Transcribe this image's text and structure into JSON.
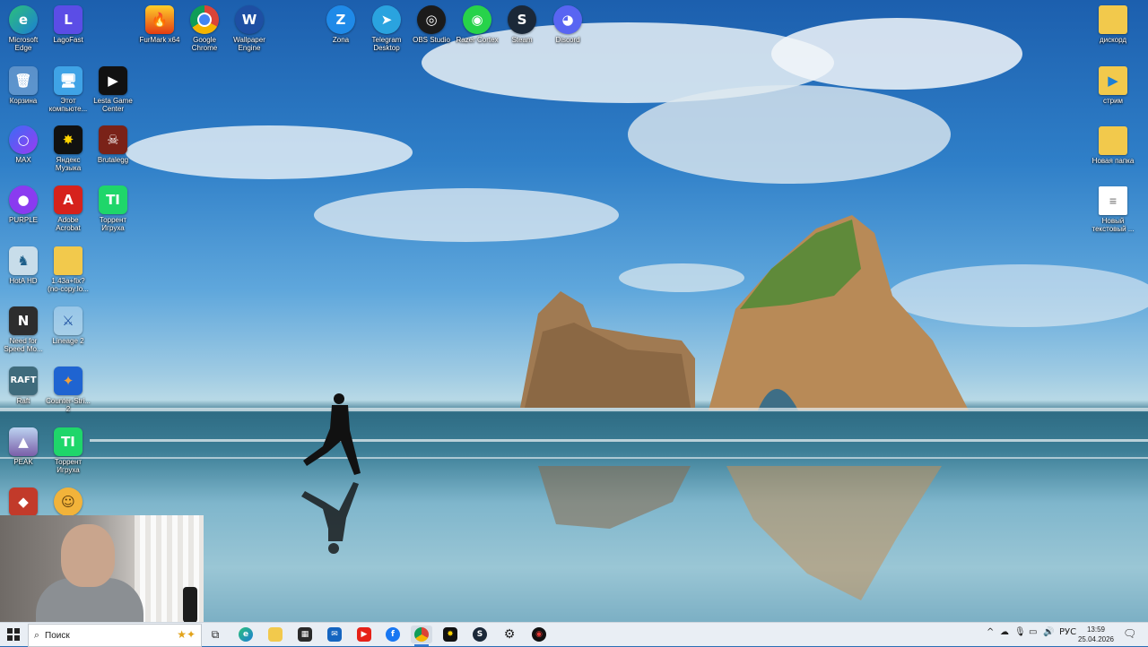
{
  "desktop_icons": {
    "edge": {
      "label": "Microsoft Edge",
      "icon": "edge-icon"
    },
    "lagofast": {
      "label": "LagoFast",
      "icon": "lagofast-icon"
    },
    "furmark": {
      "label": "FurMark x64",
      "icon": "furmark-icon"
    },
    "chrome": {
      "label": "Google Chrome",
      "icon": "chrome-icon"
    },
    "wallpaper_engine": {
      "label": "Wallpaper Engine",
      "icon": "wallpaper-engine-icon"
    },
    "zona": {
      "label": "Zona",
      "icon": "zona-icon"
    },
    "telegram": {
      "label": "Telegram Desktop",
      "icon": "telegram-icon"
    },
    "obs": {
      "label": "OBS Studio",
      "icon": "obs-icon"
    },
    "razer": {
      "label": "Razer Cortex",
      "icon": "razer-icon"
    },
    "steam": {
      "label": "Steam",
      "icon": "steam-icon"
    },
    "discord": {
      "label": "Discord",
      "icon": "discord-icon"
    },
    "recycle": {
      "label": "Корзина",
      "icon": "recycle-bin-icon"
    },
    "this_pc": {
      "label": "Этот компьюте...",
      "icon": "computer-icon"
    },
    "lesta": {
      "label": "Lesta Game Center",
      "icon": "lesta-icon"
    },
    "max": {
      "label": "MAX",
      "icon": "max-icon"
    },
    "yandex_music": {
      "label": "Яндекс Музыка",
      "icon": "yandex-music-icon"
    },
    "brutal": {
      "label": "Brutalegg",
      "icon": "brutal-game-icon"
    },
    "purple": {
      "label": "PURPLE",
      "icon": "purple-icon"
    },
    "acrobat": {
      "label": "Adobe Acrobat",
      "icon": "acrobat-icon"
    },
    "torrent1": {
      "label": "Торрент Игруха",
      "icon": "torrent-icon"
    },
    "hota": {
      "label": "HotA HD",
      "icon": "hota-icon"
    },
    "folder_nocopy": {
      "label": "1.43a+fix? (no-copy.lo...",
      "icon": "folder-icon"
    },
    "nfs": {
      "label": "Need for Speed Mo...",
      "icon": "nfs-icon"
    },
    "lineage": {
      "label": "Lineage 2",
      "icon": "lineage-icon"
    },
    "raft": {
      "label": "Raft",
      "icon": "raft-icon"
    },
    "cs": {
      "label": "Counter-Stri... 2",
      "icon": "counter-strike-icon"
    },
    "peak": {
      "label": "PEAK",
      "icon": "peak-icon"
    },
    "torrent2": {
      "label": "Торрент Игруха",
      "icon": "torrent-icon"
    },
    "game_red": {
      "label": "",
      "icon": "game-icon"
    },
    "game_emoji": {
      "label": "",
      "icon": "emoji-game-icon"
    },
    "discord_folder": {
      "label": "дискорд",
      "icon": "folder-icon"
    },
    "stream_folder": {
      "label": "стрим",
      "icon": "folder-icon"
    },
    "new_folder": {
      "label": "Новая папка",
      "icon": "folder-icon"
    },
    "new_text": {
      "label": "Новый текстовый ...",
      "icon": "text-file-icon"
    }
  },
  "taskbar": {
    "search_placeholder": "Поиск",
    "apps": [
      "task-view-icon",
      "edge-icon",
      "explorer-icon",
      "store-icon",
      "mail-icon",
      "youtube-icon",
      "facebook-icon",
      "chrome-icon",
      "yandex-music-icon",
      "steam-icon",
      "settings-icon",
      "razer-icon"
    ],
    "tray": {
      "language": "РУС",
      "time": "13:59",
      "date": "25.04.2026"
    }
  },
  "colors": {
    "taskbar_bg": "#e9eef4",
    "accent": "#3a7bd5"
  }
}
